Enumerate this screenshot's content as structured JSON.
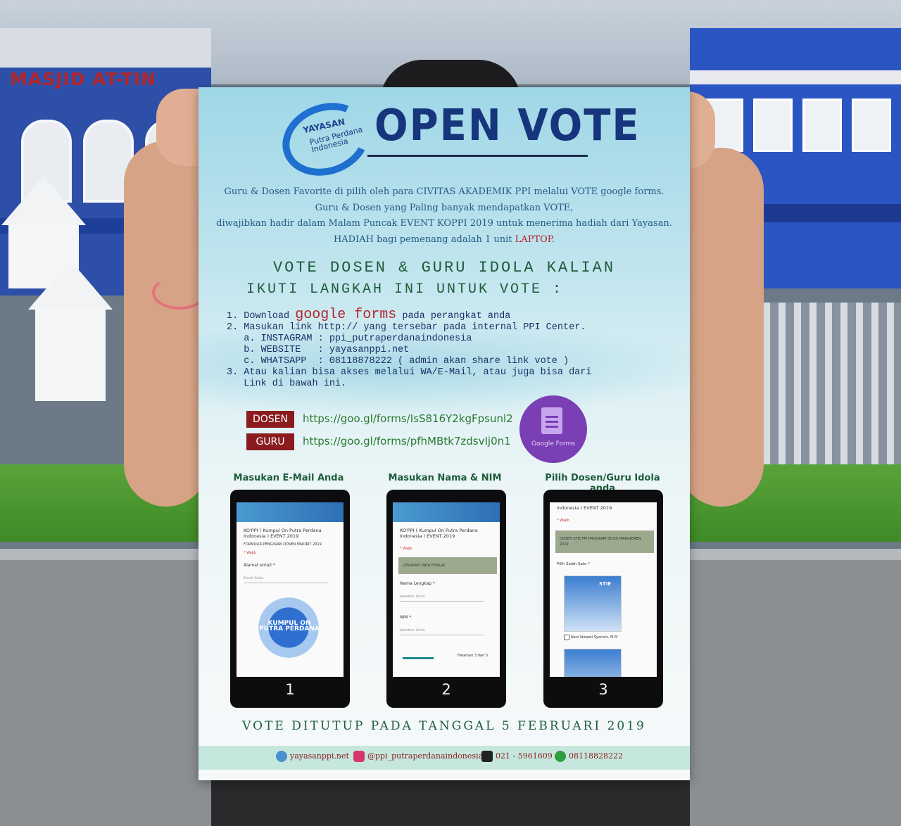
{
  "background": {
    "building_sign": "MASJID AT-TIN"
  },
  "poster": {
    "logo": {
      "line1": "YAYASAN",
      "line2": "Putra Perdana Indonesia"
    },
    "title": "OPEN VOTE",
    "intro": {
      "line1": "Guru & Dosen Favorite di pilih oleh para CIVITAS AKADEMIK PPI melalui VOTE google forms.",
      "line2": "Guru & Dosen yang Paling banyak mendapatkan VOTE,",
      "line3": "diwajibkan hadir dalam Malam Puncak EVENT KOPPI 2019 untuk menerima hadiah dari Yayasan.",
      "line4_a": "HADIAH bagi pemenang adalah 1 unit ",
      "line4_b": "LAPTOP",
      "line4_c": "."
    },
    "heading_vote": "VOTE DOSEN & GURU IDOLA KALIAN",
    "heading_steps": "IKUTI LANGKAH INI UNTUK VOTE :",
    "steps": {
      "s1_a": "1. Download ",
      "s1_b": "google forms",
      "s1_c": " pada perangkat anda",
      "s2": "2. Masukan link http:// yang tersebar pada internal PPI Center.",
      "s2a": "   a. INSTAGRAM : ppi_putraperdanaindonesia",
      "s2b": "   b. WEBSITE   : yayasanppi.net",
      "s2c": "   c. WHATSAPP  : 08118878222 ( admin akan share link vote )",
      "s3_1": "3. Atau kalian bisa akses melalui WA/E-Mail, atau juga bisa dari",
      "s3_2": "   Link di bawah ini."
    },
    "links": [
      {
        "tag": "DOSEN",
        "url": "https://goo.gl/forms/IsS816Y2kgFpsunl2"
      },
      {
        "tag": "GURU",
        "url": "https://goo.gl/forms/pfhMBtk7zdsvIj0n1"
      }
    ],
    "google_forms_badge": "Google Forms",
    "phones": [
      {
        "label": "Masukan E-Mail Anda",
        "number": "1",
        "screen": {
          "heading": "KO'PPI ( Kumpul On Putra Perdana Indonesia ) EVENT 2019",
          "sub": "FORMULIR PENGISIAN DOSEN FAVORIT 2019",
          "required": "* Wajib",
          "field": "Alamat email *",
          "placeholder": "Email Anda",
          "art": "KUMPUL ON PUTRA PERDANA"
        }
      },
      {
        "label": "Masukan Nama & NIM",
        "number": "2",
        "screen": {
          "heading": "KO'PPI ( Kumpul On Putra Perdana Indonesia ) EVENT 2019",
          "required": "* Wajib",
          "section": "LENGKAPI DATA PENILAI",
          "field1": "Nama Lengkap *",
          "placeholder1": "Jawaban Anda",
          "field2": "NIM *",
          "placeholder2": "Jawaban Anda",
          "page": "Halaman 3 dari 5"
        }
      },
      {
        "label": "Pilih Dosen/Guru Idola anda",
        "number": "3",
        "screen": {
          "heading": "Indonesia ) EVENT 2019",
          "required": "* Wajib",
          "section": "DOSEN STIE PPI PROGRAM STUDI MANAJEMEN 2019",
          "prompt": "Pilih Salah Satu *",
          "photo_tag": "STIE",
          "option1": "Nani Idawati Syamsir, M.M"
        }
      }
    ],
    "closing": "VOTE DITUTUP PADA TANGGAL 5 FEBRUARI 2019",
    "footer": {
      "website": "yayasanppi.net",
      "instagram": "@ppi_putraperdanaindonesia",
      "phone": "021 - 5961609",
      "whatsapp": "08118828222"
    }
  },
  "colors": {
    "title": "#16357c",
    "accent_red": "#8a1c1f",
    "link_green": "#2a7a2f",
    "google_forms_purple": "#7a3eb5"
  }
}
